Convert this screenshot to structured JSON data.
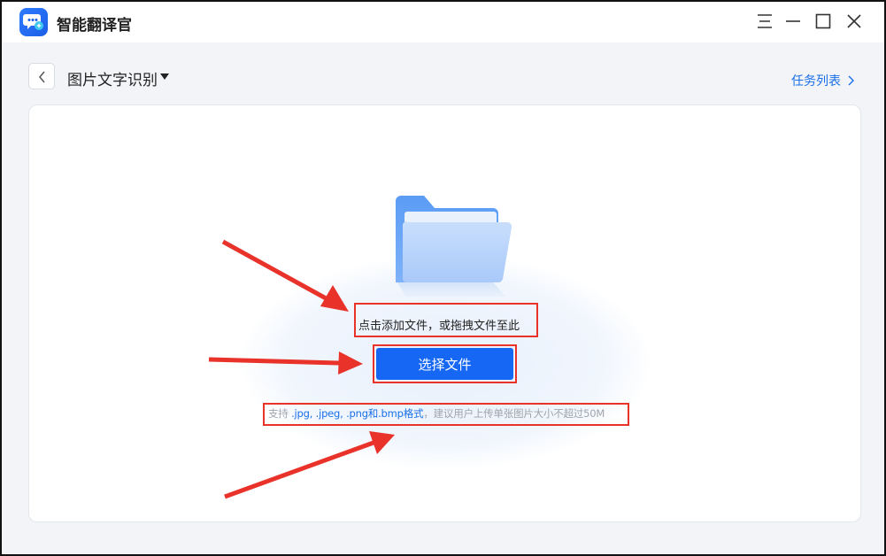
{
  "app": {
    "name": "智能翻译官"
  },
  "header": {
    "title": "图片文字识别",
    "task_list_label": "任务列表"
  },
  "upload": {
    "hint": "点击添加文件，或拖拽文件至此",
    "button_label": "选择文件",
    "support_prefix": "支持",
    "support_formats": " .jpg, .jpeg, .png和.bmp格式",
    "support_suffix": "，建议用户上传单张图片大小不超过50M"
  },
  "colors": {
    "accent": "#1668f4",
    "link": "#1a6fe8",
    "annotation": "#e8322a"
  },
  "icons": [
    "app-logo-icon",
    "menu-icon",
    "minimize-icon",
    "maximize-icon",
    "close-icon",
    "back-arrow-icon",
    "caret-down-icon",
    "chevron-right-icon",
    "folder-icon"
  ]
}
